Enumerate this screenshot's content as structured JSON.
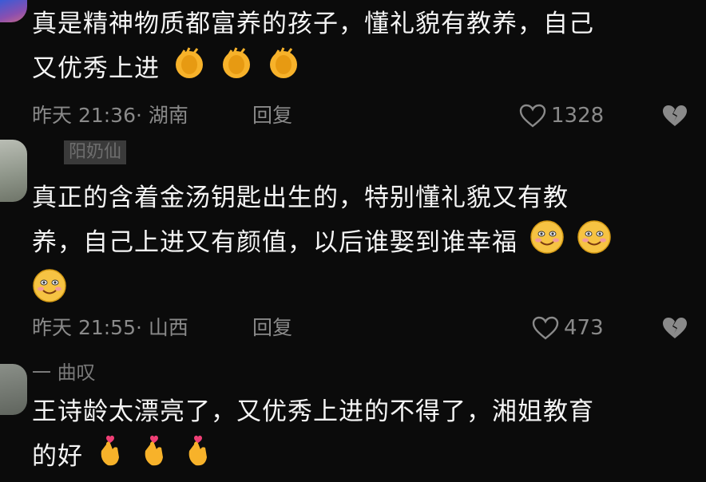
{
  "comments": [
    {
      "text_line1": "真是精神物质都富养的孩子，懂礼貌有教养，自己",
      "text_line2": "又优秀上进",
      "time": "昨天 21:36",
      "location": "· 湖南",
      "reply_label": "回复",
      "likes": "1328",
      "emoji": "clap"
    },
    {
      "username": "阳奶仙",
      "text_line1": "真正的含着金汤钥匙出生的，特别懂礼貌又有教",
      "text_line2": "养，自己上进又有颜值，以后谁娶到谁幸福",
      "time": "昨天 21:55",
      "location": "· 山西",
      "reply_label": "回复",
      "likes": "473",
      "emoji": "smile"
    },
    {
      "username": "一 曲叹",
      "text_line1": "王诗龄太漂亮了，又优秀上进的不得了，湘姐教育",
      "text_line2": "的好",
      "emoji": "finger-heart"
    }
  ],
  "colors": {
    "background": "#0b0b0b",
    "text": "#f4f4f4",
    "meta": "#8a8a8a"
  }
}
